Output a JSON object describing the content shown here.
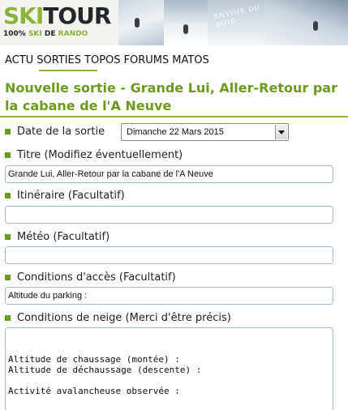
{
  "banner": {
    "logo_ski": "SKI",
    "logo_tour": "TOUR",
    "tagline_prefix": "100%",
    "tagline_ski": "SKI",
    "tagline_de": "DE",
    "tagline_rando": "RANDO",
    "photo_caption": "ENVOIE DU BOIS"
  },
  "nav": {
    "items": [
      {
        "label": "ACTU",
        "active": false
      },
      {
        "label": "SORTIES",
        "active": true
      },
      {
        "label": "TOPOS",
        "active": false
      },
      {
        "label": "FORUMS",
        "active": false
      },
      {
        "label": "MATOS",
        "active": false
      }
    ],
    "accent_color": "#8cb43a"
  },
  "page": {
    "title": "Nouvelle sortie - Grande Lui, Aller-Retour par la cabane de l'A Neuve",
    "title_color": "#6b9a1e"
  },
  "form": {
    "date": {
      "label": "Date de la sortie",
      "value": "Dimanche 22 Mars 2015"
    },
    "titre": {
      "label": "Titre (Modifiez éventuellement)",
      "value": "Grande Lui, Aller-Retour par la cabane de l'A Neuve"
    },
    "itineraire": {
      "label": "Itinéraire (Facultatif)",
      "value": ""
    },
    "meteo": {
      "label": "Météo (Facultatif)",
      "value": ""
    },
    "acces": {
      "label": "Conditions d'accès (Facultatif)",
      "value": "Altitude du parking :"
    },
    "neige": {
      "label": "Conditions de neige (Merci d'être précis)",
      "value": "\n\nAltitude de chaussage (montée) :\nAltitude de déchaussage (descente) :\n\nActivité avalancheuse observée :"
    }
  }
}
